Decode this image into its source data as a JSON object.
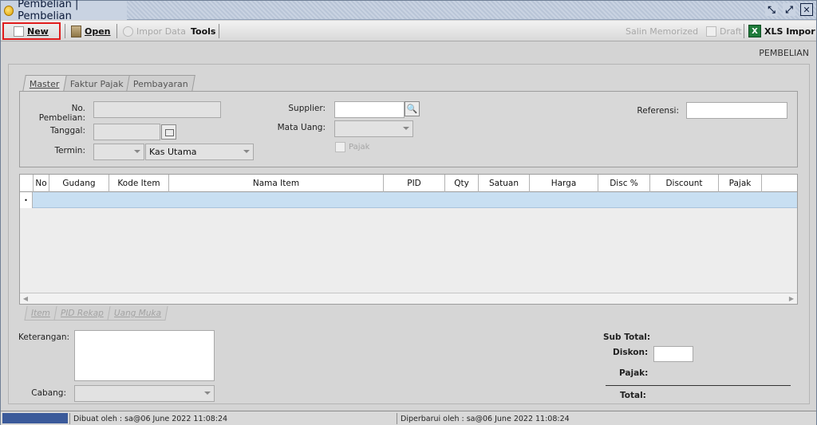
{
  "window": {
    "title": "Pembelian | Pembelian",
    "controls": [
      "restore",
      "maximize",
      "close"
    ]
  },
  "toolbar": {
    "new_label": "New",
    "open_label": "Open",
    "import_label": "Impor Data",
    "tools_label": "Tools",
    "salin_label": "Salin Memorized",
    "draft_label": "Draft",
    "xls_label": "XLS Impor"
  },
  "form_title": "PEMBELIAN",
  "tabs": [
    {
      "label": "Master",
      "active": true
    },
    {
      "label": "Faktur Pajak",
      "active": false
    },
    {
      "label": "Pembayaran",
      "active": false
    }
  ],
  "master": {
    "no_pembelian_label": "No. Pembelian:",
    "no_pembelian_value": "",
    "tanggal_label": "Tanggal:",
    "tanggal_value": "",
    "termin_label": "Termin:",
    "termin_value": "",
    "kas_value": "Kas Utama",
    "supplier_label": "Supplier:",
    "supplier_value": "",
    "mata_uang_label": "Mata Uang:",
    "mata_uang_value": "",
    "pajak_label": "Pajak",
    "referensi_label": "Referensi:",
    "referensi_value": ""
  },
  "grid": {
    "columns": [
      "No",
      "Gudang",
      "Kode Item",
      "Nama Item",
      "PID",
      "Qty",
      "Satuan",
      "Harga",
      "Disc %",
      "Discount",
      "Pajak"
    ],
    "rows": []
  },
  "sub_tabs": [
    "Item",
    "PID Rekap",
    "Uang Muka"
  ],
  "bottom": {
    "keterangan_label": "Keterangan:",
    "cabang_label": "Cabang:",
    "sub_total_label": "Sub Total:",
    "diskon_label": "Diskon:",
    "pajak_label": "Pajak:",
    "total_label": "Total:"
  },
  "status": {
    "dibuat": "Dibuat oleh : sa@06 June 2022  11:08:24",
    "diperbarui": "Diperbarui oleh : sa@06 June 2022  11:08:24"
  },
  "colors": {
    "title_bar": "#c9d3e2",
    "highlight_border": "#e01c1c",
    "selected_row": "#c8dff2",
    "status_blue": "#3b5a9a"
  }
}
